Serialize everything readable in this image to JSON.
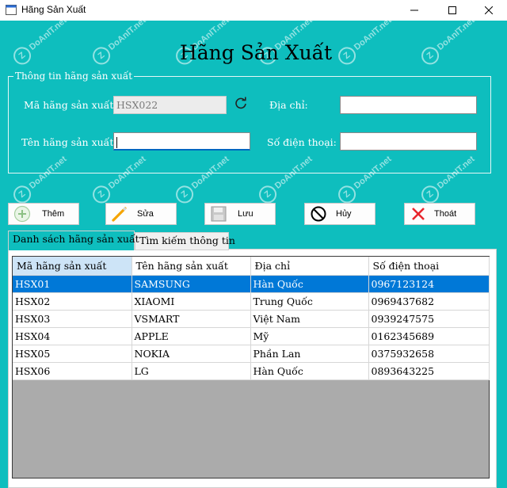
{
  "window": {
    "title": "Hãng Sản Xuất"
  },
  "heading": "Hãng Sản Xuất",
  "group": {
    "legend": "Thông tin hãng sản xuất",
    "ma_label": "Mã hãng sản xuất:",
    "ma_value": "HSX022",
    "ten_label": "Tên hãng sản xuất:",
    "ten_value": "",
    "diachi_label": "Địa chỉ:",
    "diachi_value": "",
    "sdt_label": "Số điện thoại:",
    "sdt_value": ""
  },
  "buttons": {
    "them": "Thêm",
    "sua": "Sửa",
    "luu": "Lưu",
    "huy": "Hủy",
    "thoat": "Thoát"
  },
  "tabs": [
    {
      "label": "Danh sách hãng sản xuất"
    },
    {
      "label": "Tìm kiếm thông tin"
    }
  ],
  "table": {
    "columns": [
      "Mã hãng sản xuất",
      "Tên hãng sản xuất",
      "Địa chỉ",
      "Số điện thoại"
    ],
    "rows": [
      [
        "HSX01",
        "SAMSUNG",
        "Hàn Quốc",
        "0967123124"
      ],
      [
        "HSX02",
        "XIAOMI",
        "Trung Quốc",
        "0969437682"
      ],
      [
        "HSX03",
        "VSMART",
        "Việt Nam",
        "0939247575"
      ],
      [
        "HSX04",
        "APPLE",
        "Mỹ",
        "0162345689"
      ],
      [
        "HSX05",
        "NOKIA",
        "Phần Lan",
        "0375932658"
      ],
      [
        "HSX06",
        "LG",
        "Hàn Quốc",
        "0893643225"
      ]
    ]
  },
  "watermark": "DoAnIT.net",
  "colors": {
    "background": "#0ebebe",
    "selection": "#0078d7"
  }
}
